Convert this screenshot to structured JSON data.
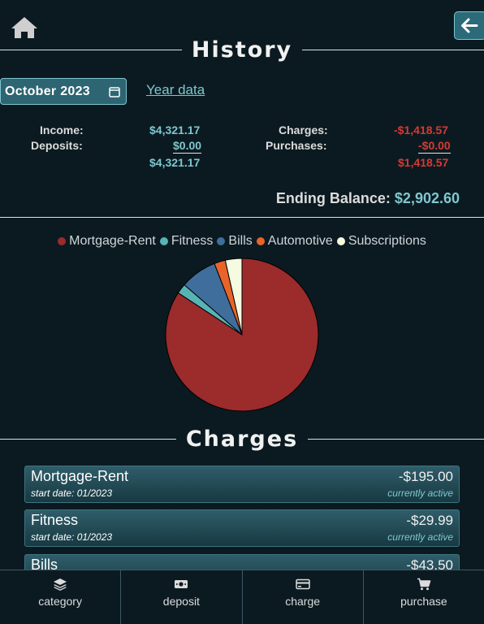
{
  "title": "History",
  "month_value": "October  2023",
  "year_link": "Year data",
  "summary": {
    "income_label": "Income:",
    "income_value": "$4,321.17",
    "deposits_label": "Deposits:",
    "deposits_value": "$0.00",
    "income_total": "$4,321.17",
    "charges_label": "Charges:",
    "charges_value": "-$1,418.57",
    "purchases_label": "Purchases:",
    "purchases_value": "-$0.00",
    "charges_total": "$1,418.57"
  },
  "ending_label": "Ending Balance:",
  "ending_value": "$2,902.60",
  "chart_data": {
    "type": "pie",
    "categories": [
      "Mortgage-Rent",
      "Fitness",
      "Bills",
      "Automotive",
      "Subscriptions"
    ],
    "values": [
      1195.0,
      29.99,
      110.0,
      33.58,
      50.0
    ],
    "colors": [
      "#9c2b2b",
      "#58b4b4",
      "#3f6e9c",
      "#e8642a",
      "#f4fbe0"
    ],
    "legend_position": "top"
  },
  "charges_title": "Charges",
  "charges": [
    {
      "name": "Mortgage-Rent",
      "amount": "-$195.00",
      "start": "start date: 01/2023",
      "status": "currently active"
    },
    {
      "name": "Fitness",
      "amount": "-$29.99",
      "start": "start date: 01/2023",
      "status": "currently active"
    },
    {
      "name": "Bills",
      "amount": "-$43.50",
      "start": "",
      "status": ""
    }
  ],
  "nav": [
    {
      "label": "category",
      "icon": "layers-icon"
    },
    {
      "label": "deposit",
      "icon": "cash-icon"
    },
    {
      "label": "charge",
      "icon": "credit-card-icon"
    },
    {
      "label": "purchase",
      "icon": "cart-icon"
    }
  ]
}
